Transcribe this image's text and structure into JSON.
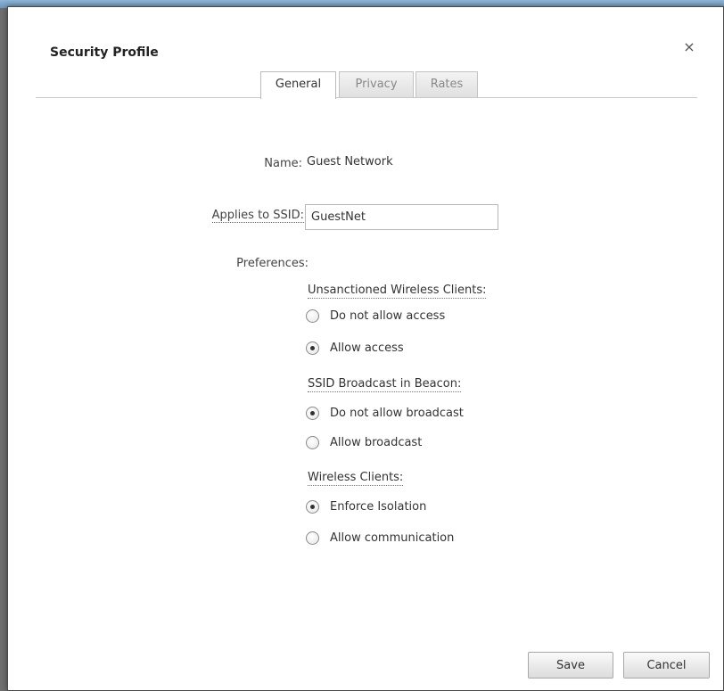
{
  "dialog": {
    "title": "Security Profile",
    "close_glyph": "×",
    "close_icon": "close-icon"
  },
  "tabs": [
    {
      "label": "General",
      "active": true
    },
    {
      "label": "Privacy",
      "active": false
    },
    {
      "label": "Rates",
      "active": false
    }
  ],
  "form": {
    "name_label": "Name:",
    "name_value": "Guest Network",
    "ssid_label": "Applies to SSID:",
    "ssid_value": "GuestNet",
    "preferences_label": "Preferences:"
  },
  "sections": {
    "unsanctioned": {
      "title": "Unsanctioned Wireless Clients:",
      "options": [
        {
          "label": "Do not allow access",
          "checked": false
        },
        {
          "label": "Allow access",
          "checked": true
        }
      ]
    },
    "broadcast": {
      "title": "SSID Broadcast in Beacon:",
      "options": [
        {
          "label": "Do not allow broadcast",
          "checked": true
        },
        {
          "label": "Allow broadcast",
          "checked": false
        }
      ]
    },
    "clients": {
      "title": "Wireless Clients:",
      "options": [
        {
          "label": "Enforce Isolation",
          "checked": true
        },
        {
          "label": "Allow communication",
          "checked": false
        }
      ]
    }
  },
  "buttons": {
    "save": "Save",
    "cancel": "Cancel"
  },
  "colors": {
    "header_strip": "#7aa5cb",
    "backdrop": "#6f6f6f"
  }
}
